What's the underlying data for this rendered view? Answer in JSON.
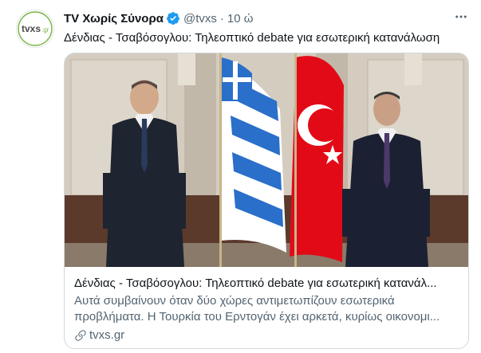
{
  "tweet": {
    "author_name": "TV Χωρίς Σύνορα",
    "handle": "@tvxs",
    "separator": "·",
    "time": "10 ώ",
    "text": "Δένδιας - Τσαβόσογλου: Τηλεοπτικό debate για εσωτερική κατανάλωση",
    "avatar_logo_text": "tvxs",
    "avatar_logo_suffix": ".gr"
  },
  "card": {
    "title": "Δένδιας - Τσαβόσογλου: Τηλεοπτικό debate για εσωτερική κατανάλ...",
    "description": "Αυτά συμβαίνουν όταν δύο χώρες αντιμετωπίζουν εσωτερικά προβλήματα. Η Τουρκία του Ερντογάν έχει αρκετά, κυρίως οικονομι...",
    "domain": "tvxs.gr"
  },
  "colors": {
    "verified": "#1d9bf0",
    "greek_blue": "#2a6fc9",
    "turkish_red": "#e30a17"
  },
  "icons": {
    "verified": "verified-badge-icon",
    "more": "more-options-icon",
    "link": "link-icon"
  }
}
